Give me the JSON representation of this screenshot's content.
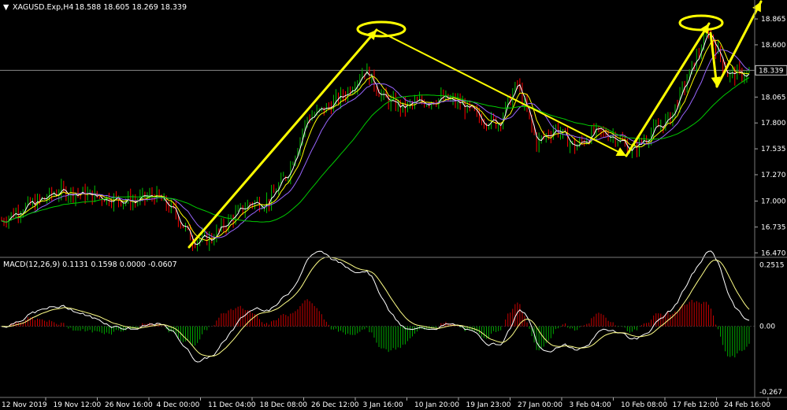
{
  "window": {
    "symbol_line": "XAGUSD.Exp,H4",
    "ohlc": "18.588 18.605 18.269 18.339",
    "macd_label": "MACD(12,26,9) 0.1131 0.1598 0.0000 -0.0607"
  },
  "colors": {
    "background": "#000000",
    "bull_candle": "#00c000",
    "bear_candle": "#ff0000",
    "ma_fast": "#ffffff",
    "ma_mid": "#ffff00",
    "ma_slow": "#9966ff",
    "ma_long": "#00cc00",
    "annotation": "#ffff00",
    "macd_hist_pos": "#cc0000",
    "macd_hist_neg": "#00aa00",
    "macd_line": "#ffffff",
    "signal_line": "#ffff88",
    "grid": "#555555",
    "current_price_line": "#888888"
  },
  "chart_data": {
    "type": "candlestick",
    "price_axis": {
      "ticks": [
        "18.865",
        "18.600",
        "18.065",
        "17.800",
        "17.535",
        "17.270",
        "17.000",
        "16.735",
        "16.470"
      ],
      "tick_values": [
        18.865,
        18.6,
        18.065,
        17.8,
        17.535,
        17.27,
        17.0,
        16.735,
        16.47
      ],
      "current_price": "18.339",
      "ylim": [
        16.44,
        18.93
      ]
    },
    "macd_axis": {
      "ticks": [
        "0.2515",
        "0.00",
        "-0.267"
      ],
      "tick_values": [
        0.2515,
        0.0,
        -0.267
      ],
      "ylim": [
        -0.29,
        0.275
      ]
    },
    "time_axis": {
      "labels": [
        "12 Nov 2019",
        "19 Nov 12:00",
        "26 Nov 16:00",
        "4 Dec 00:00",
        "11 Dec 04:00",
        "18 Dec 08:00",
        "26 Dec 12:00",
        "3 Jan 16:00",
        "10 Jan 20:00",
        "19 Jan 23:00",
        "27 Jan 00:00",
        "3 Feb 04:00",
        "10 Feb 08:00",
        "17 Feb 12:00",
        "24 Feb 16:00"
      ]
    },
    "price_path_index": [
      0,
      8,
      16,
      24,
      32,
      40,
      48,
      56,
      64,
      72,
      80,
      88,
      96,
      104,
      112,
      120,
      128,
      136,
      144,
      152,
      160,
      168,
      176,
      184,
      192,
      200,
      208,
      216,
      224,
      232,
      240,
      248,
      256,
      264,
      272,
      280,
      288,
      296,
      304,
      312
    ],
    "price_path": [
      16.8,
      16.92,
      17.0,
      17.1,
      17.08,
      17.05,
      17.02,
      17.0,
      17.06,
      16.9,
      16.6,
      16.62,
      16.82,
      16.98,
      17.0,
      17.3,
      17.85,
      17.95,
      18.1,
      18.35,
      18.05,
      17.95,
      18.02,
      18.05,
      18.0,
      17.85,
      17.8,
      18.2,
      17.6,
      17.75,
      17.55,
      17.7,
      17.68,
      17.52,
      17.7,
      17.85,
      18.3,
      18.75,
      18.3,
      18.3
    ],
    "annotation_markers": [
      {
        "type": "ellipse",
        "label": "top-1"
      },
      {
        "type": "ellipse",
        "label": "top-2"
      }
    ]
  }
}
